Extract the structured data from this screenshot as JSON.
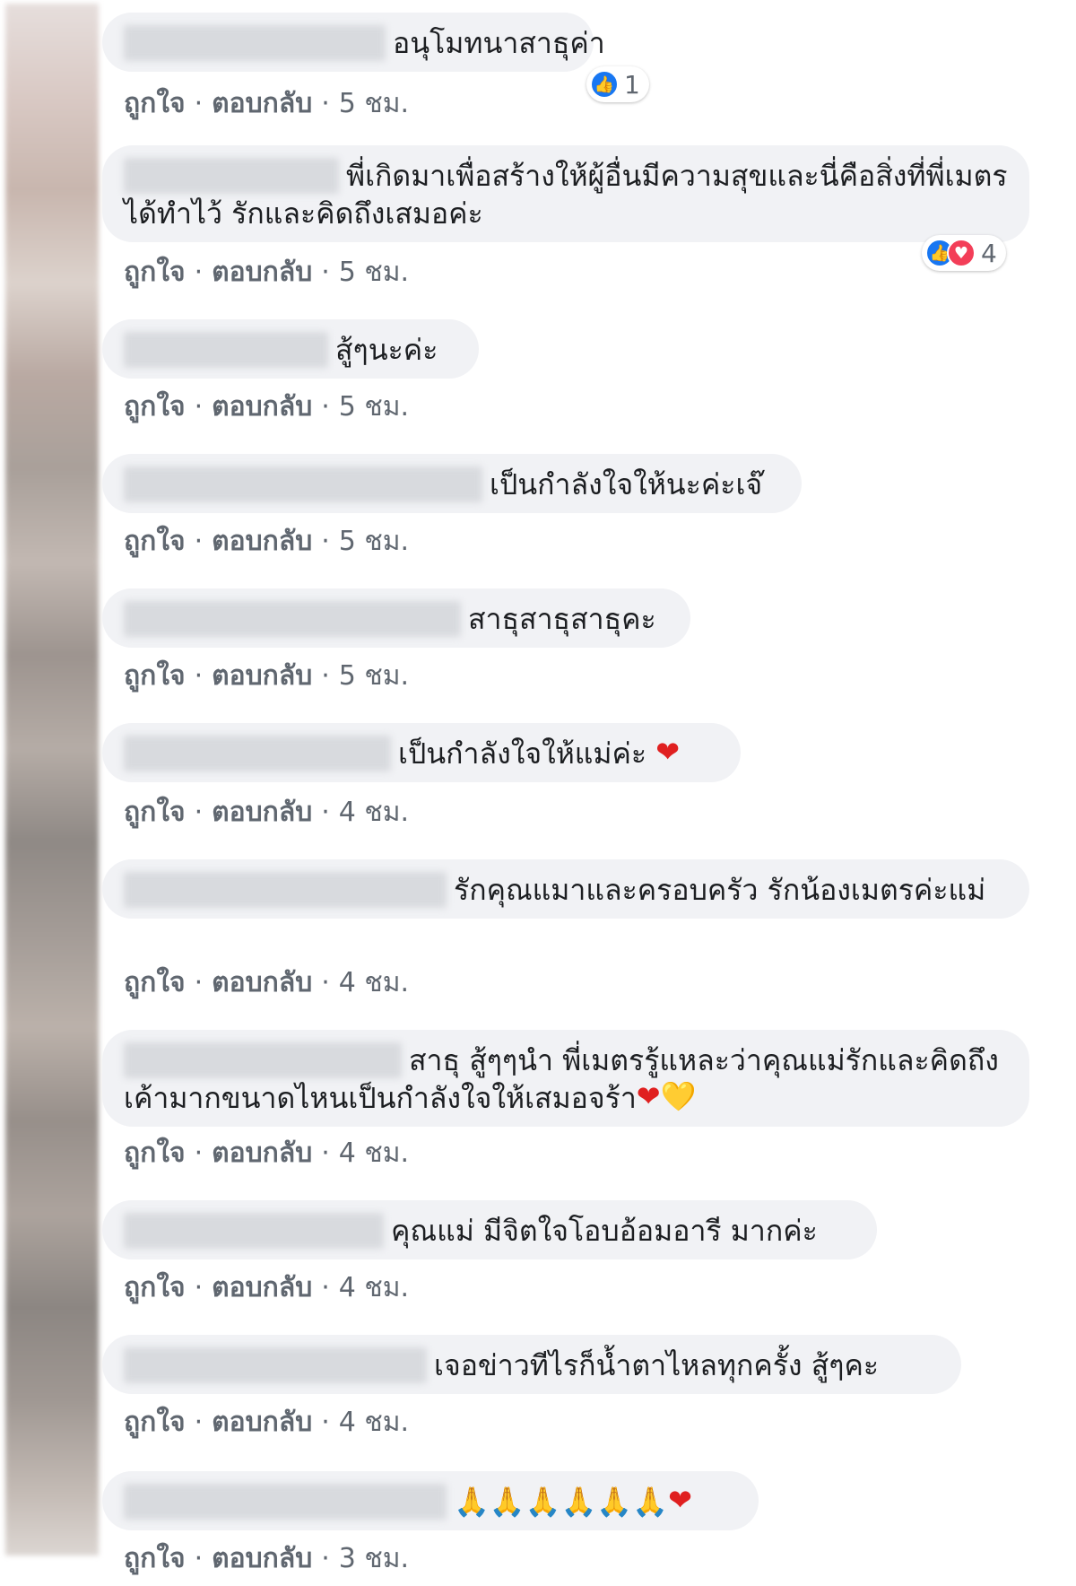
{
  "action_like": "ถูกใจ",
  "action_reply": "ตอบกลับ",
  "separator": "·",
  "comments": [
    {
      "text": "อนุโมทนาสาธุค่า",
      "time": "5 ชม.",
      "reaction_count": "1"
    },
    {
      "text": "พี่เกิดมาเพื่อสร้างให้ผู้อื่นมีความสุขและนี่คือสิ่งที่พี่เมตรได้ทำไว้ รักและคิดถึงเสมอค่ะ",
      "time": "5 ชม.",
      "reaction_count": "4"
    },
    {
      "text": "สู้ๆนะค่ะ",
      "time": "5 ชม."
    },
    {
      "text": "เป็นกำลังใจให้นะค่ะเจ๊",
      "time": "5 ชม."
    },
    {
      "text": "สาธุสาธุสาธุคะ",
      "time": "5 ชม."
    },
    {
      "text": "เป็นกำลังใจให้แม่ค่ะ",
      "emoji": "❤",
      "time": "4 ชม."
    },
    {
      "text": "รักคุณแมาและครอบครัว รักน้องเมตรค่ะแม่",
      "time": "4 ชม."
    },
    {
      "text": "สาธุ สู้ๆๆนํา พี่เมตรรู้แหละว่าคุณแม่รักและคิดถึงเค้ามากขนาดไหนเป็นกำลังใจให้เสมอจร้า",
      "emoji": "❤",
      "emoji2": "💛",
      "time": "4 ชม."
    },
    {
      "text": "คุณแม่ มีจิตใจโอบอ้อมอารี มากค่ะ",
      "time": "4 ชม."
    },
    {
      "text": "เจอข่าวทีไรก็น้ำตาไหลทุกครั้ง สู้ๆคะ",
      "time": "4 ชม."
    },
    {
      "text": "🙏🙏🙏🙏🙏🙏",
      "emoji": "❤",
      "time": "3 ชม."
    }
  ],
  "reaction_icons": [
    "like-icon",
    "love-icon"
  ],
  "colors": {
    "bubble": "#f1f2f5",
    "meta_text": "#606770",
    "like_blue": "#1877f2",
    "love_red": "#f33e58"
  }
}
